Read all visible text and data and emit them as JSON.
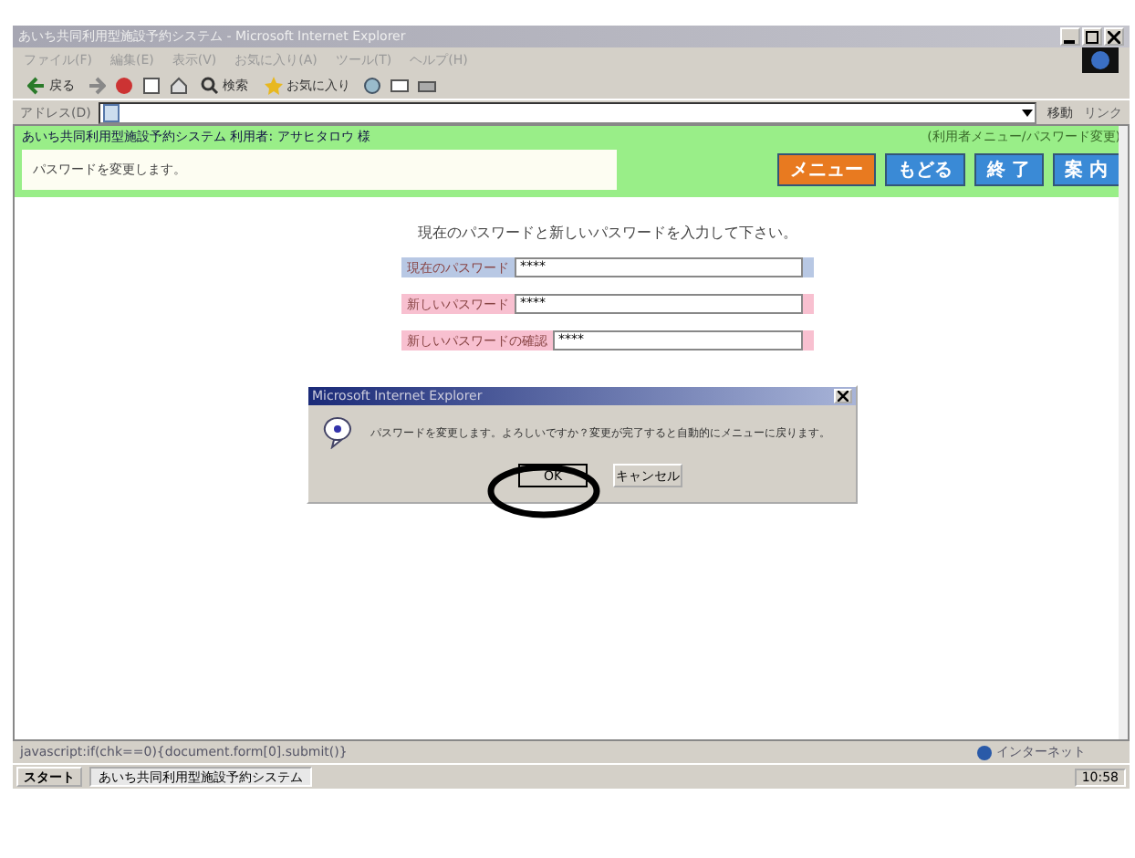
{
  "window": {
    "title": "あいち共同利用型施設予約システム - Microsoft Internet Explorer"
  },
  "menu": [
    "ファイル(F)",
    "編集(E)",
    "表示(V)",
    "お気に入り(A)",
    "ツール(T)",
    "ヘルプ(H)"
  ],
  "toolbar": [
    "戻る",
    "検索",
    "お気に入り"
  ],
  "address_bar": {
    "label": "アドレス(D)",
    "go": "移動",
    "links": "リンク"
  },
  "header": {
    "system": "あいち共同利用型施設予約システム 利用者: アサヒタロウ 様",
    "breadcrumb": "(利用者メニュー/パスワード変更)",
    "message": "パスワードを変更します。",
    "buttons": [
      {
        "label": "メニュー",
        "kind": "orange"
      },
      {
        "label": "もどる",
        "kind": "blue"
      },
      {
        "label": "終 了",
        "kind": "blue"
      },
      {
        "label": "案 内",
        "kind": "blue"
      }
    ]
  },
  "form": {
    "instruction": "現在のパスワードと新しいパスワードを入力して下さい。",
    "fields": [
      {
        "label": "現在のパスワード",
        "value": "****",
        "kind": "current"
      },
      {
        "label": "新しいパスワード",
        "value": "****",
        "kind": "new"
      },
      {
        "label": "新しいパスワードの確認",
        "value": "****",
        "kind": "new"
      }
    ]
  },
  "dialog": {
    "title": "Microsoft Internet Explorer",
    "message": "パスワードを変更します。よろしいですか？変更が完了すると自動的にメニューに戻ります。",
    "buttons": [
      {
        "label": "OK",
        "selected": true
      },
      {
        "label": "キャンセル",
        "selected": false
      }
    ]
  },
  "status_bar": {
    "text": "javascript:if(chk==0){document.form[0].submit()}",
    "zone": "インターネット"
  },
  "taskbar": {
    "start": "スタート",
    "task": "あいち共同利用型施設予約システム",
    "clock": "10:58"
  }
}
